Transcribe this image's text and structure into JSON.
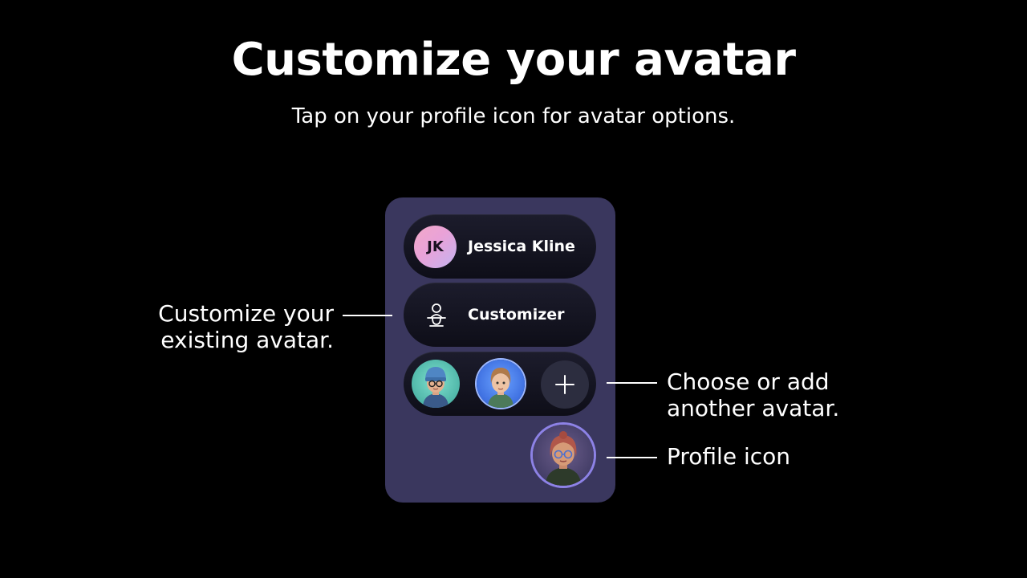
{
  "header": {
    "title": "Customize your avatar",
    "subtitle": "Tap on your profile icon for avatar options."
  },
  "panel": {
    "user": {
      "initials": "JK",
      "name": "Jessica Kline"
    },
    "customizer": {
      "icon": "avatar-figure-icon",
      "label": "Customizer"
    },
    "avatars": {
      "add_icon": "plus-icon"
    },
    "profile_icon": "avatar-portrait"
  },
  "callouts": {
    "customize_line1": "Customize your",
    "customize_line2": "existing avatar.",
    "choose_line1": "Choose or add",
    "choose_line2": "another avatar.",
    "profile": "Profile icon"
  },
  "colors": {
    "background": "#000000",
    "panel": "#3a375e",
    "pill": "#14141f",
    "profile_ring": "#8d82e6"
  }
}
